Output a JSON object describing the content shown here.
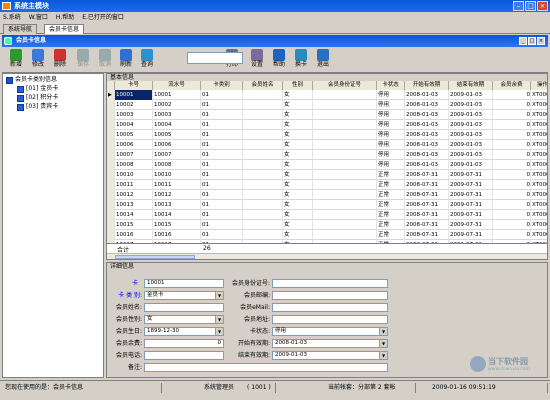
{
  "window": {
    "title": "系统主模块"
  },
  "menu": [
    "S.系统",
    "W.窗口",
    "H.帮助",
    "E.已打开的窗口"
  ],
  "tabs": [
    "系统导航",
    "会员卡信息"
  ],
  "inner": {
    "title": "会员卡信息"
  },
  "toolbar": [
    {
      "label": "新增",
      "icon": "add-icon",
      "color": "#2a9a2a",
      "enabled": true
    },
    {
      "label": "修改",
      "icon": "edit-icon",
      "color": "#3c78d8",
      "enabled": true
    },
    {
      "label": "删除",
      "icon": "delete-icon",
      "color": "#d03030",
      "enabled": true
    },
    {
      "label": "保存",
      "icon": "save-icon",
      "color": "#9aa",
      "enabled": false
    },
    {
      "label": "取消",
      "icon": "cancel-icon",
      "color": "#9aa",
      "enabled": false
    },
    {
      "label": "刷新",
      "icon": "refresh-icon",
      "color": "#3070d0",
      "enabled": true
    },
    {
      "label": "查询",
      "icon": "search-icon",
      "color": "#2f8fd0",
      "enabled": true
    },
    {
      "label": "打印",
      "icon": "print-icon",
      "color": "#6070a0",
      "enabled": true
    },
    {
      "label": "设置",
      "icon": "settings-icon",
      "color": "#7a6aa0",
      "enabled": true
    },
    {
      "label": "帮助",
      "icon": "help-icon",
      "color": "#2060c0",
      "enabled": true
    },
    {
      "label": "换卡",
      "icon": "card-icon",
      "color": "#2a8ac0",
      "enabled": true
    },
    {
      "label": "退出",
      "icon": "exit-icon",
      "color": "#2a70c0",
      "enabled": true
    }
  ],
  "tree": {
    "root": "会员卡类别信息",
    "items": [
      "[01] 金员卡",
      "[02] 积分卡",
      "[03] 贵宾卡"
    ]
  },
  "grid": {
    "group_title": "基本信息",
    "columns": [
      "卡号",
      "流水号",
      "卡类别",
      "会员姓名",
      "性别",
      "会员身份证号",
      "卡状态",
      "开始有效期",
      "结束有效期",
      "会员余费",
      "操作"
    ],
    "rows": [
      [
        "10001",
        "10001",
        "01",
        "",
        "女",
        "",
        "停用",
        "2008-01-03",
        "2009-01-03",
        "0",
        "XT000"
      ],
      [
        "10002",
        "10002",
        "01",
        "",
        "女",
        "",
        "停用",
        "2008-01-03",
        "2009-01-03",
        "0",
        "XT000"
      ],
      [
        "10003",
        "10003",
        "01",
        "",
        "女",
        "",
        "停用",
        "2008-01-03",
        "2009-01-03",
        "0",
        "XT000"
      ],
      [
        "10004",
        "10004",
        "01",
        "",
        "女",
        "",
        "停用",
        "2008-01-03",
        "2009-01-03",
        "0",
        "XT000"
      ],
      [
        "10005",
        "10005",
        "01",
        "",
        "女",
        "",
        "停用",
        "2008-01-03",
        "2009-01-03",
        "0",
        "XT000"
      ],
      [
        "10006",
        "10006",
        "01",
        "",
        "女",
        "",
        "停用",
        "2008-01-03",
        "2009-01-03",
        "0",
        "XT000"
      ],
      [
        "10007",
        "10007",
        "01",
        "",
        "女",
        "",
        "停用",
        "2008-01-03",
        "2009-01-03",
        "0",
        "XT000"
      ],
      [
        "10008",
        "10008",
        "01",
        "",
        "女",
        "",
        "停用",
        "2008-01-03",
        "2009-01-03",
        "0",
        "XT000"
      ],
      [
        "10010",
        "10010",
        "01",
        "",
        "女",
        "",
        "正常",
        "2008-07-31",
        "2009-07-31",
        "0",
        "XT000"
      ],
      [
        "10011",
        "10011",
        "01",
        "",
        "女",
        "",
        "正常",
        "2008-07-31",
        "2009-07-31",
        "0",
        "XT000"
      ],
      [
        "10012",
        "10012",
        "01",
        "",
        "女",
        "",
        "正常",
        "2008-07-31",
        "2009-07-31",
        "0",
        "XT000"
      ],
      [
        "10013",
        "10013",
        "01",
        "",
        "女",
        "",
        "正常",
        "2008-07-31",
        "2009-07-31",
        "0",
        "XT000"
      ],
      [
        "10014",
        "10014",
        "01",
        "",
        "女",
        "",
        "正常",
        "2008-07-31",
        "2009-07-31",
        "0",
        "XT000"
      ],
      [
        "10015",
        "10015",
        "01",
        "",
        "女",
        "",
        "正常",
        "2008-07-31",
        "2009-07-31",
        "0",
        "XT000"
      ],
      [
        "10016",
        "10016",
        "01",
        "",
        "女",
        "",
        "正常",
        "2008-07-31",
        "2009-07-31",
        "0",
        "XT000"
      ],
      [
        "10017",
        "10017",
        "01",
        "",
        "女",
        "",
        "正常",
        "2008-07-31",
        "2009-07-31",
        "0",
        "XT000"
      ]
    ],
    "footer_label": "合计",
    "footer_count": "26"
  },
  "detail": {
    "group_title": "详细信息",
    "card_no_label": "卡　号:",
    "card_no": "10001",
    "card_type_label": "卡 类 别:",
    "card_type": "金员卡",
    "name_label": "会员姓名:",
    "name": "",
    "gender_label": "会员性别:",
    "gender": "女",
    "birthday_label": "会员生日:",
    "birthday": "1899-12-30",
    "balance_label": "会员余费:",
    "balance": "0",
    "phone_label": "会员电话:",
    "phone": "",
    "remark_label": "备注:",
    "remark": "",
    "idcard_label": "会员身份证号:",
    "idcard": "",
    "mailbox_label": "会员邮编:",
    "mailbox": "",
    "email_label": "会员eMail:",
    "email": "",
    "address_label": "会员地址:",
    "address": "",
    "status_label": "卡状态:",
    "status": "停用",
    "start_label": "开始有效期:",
    "start": "2008-01-03",
    "end_label": "结束有效期:",
    "end": "2009-01-03"
  },
  "status": {
    "current": "您现在使用的是：会员卡信息",
    "user": "系统管理员",
    "user_id": "( 1001 )",
    "account": "当前帐套：分部第 2 套帐",
    "time": "2009-01-16 09:51:19"
  },
  "watermark": {
    "text": "当下软件园",
    "sub": "www.downxia.com"
  }
}
